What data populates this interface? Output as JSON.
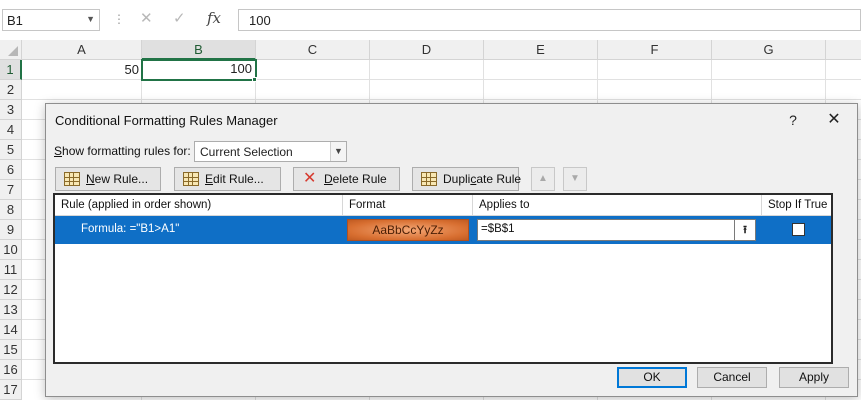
{
  "formula_bar": {
    "name_box": "B1",
    "cancel_icon": "✕",
    "enter_icon": "✓",
    "fx_label": "fx",
    "formula": "100"
  },
  "grid": {
    "columns": [
      "A",
      "B",
      "C",
      "D",
      "E",
      "F",
      "G"
    ],
    "rows": [
      "1",
      "2",
      "3",
      "4",
      "5",
      "6",
      "7",
      "8",
      "9",
      "10",
      "11",
      "12",
      "13",
      "14",
      "15",
      "16",
      "17"
    ],
    "selected_column": "B",
    "selected_row": "1",
    "cells": {
      "A1": "50",
      "B1": "100"
    },
    "accent_color": "#217346"
  },
  "dialog": {
    "title": "Conditional Formatting Rules Manager",
    "help": "?",
    "close": "✕",
    "show_label_pre": "",
    "show_label_u": "S",
    "show_label_post": "how formatting rules for:",
    "show_value": "Current Selection",
    "buttons": {
      "new_rule_u": "N",
      "new_rule_post": "ew Rule...",
      "edit_rule_u": "E",
      "edit_rule_post": "dit Rule...",
      "delete_rule_u": "D",
      "delete_rule_post": "elete Rule",
      "duplicate_pre": "Dupli",
      "duplicate_u": "c",
      "duplicate_post": "ate Rule",
      "move_up": "▲",
      "move_down": "▼"
    },
    "table_headers": {
      "rule": "Rule (applied in order shown)",
      "format": "Format",
      "applies_to": "Applies to",
      "stop_if_true": "Stop If True"
    },
    "rule_rows": [
      {
        "rule": "Formula: =\"B1>A1\"",
        "format_preview": "AaBbCcYyZz",
        "applies_to": "=$B$1",
        "stop_if_true": false
      }
    ],
    "selected_row_color": "#0f6fc6",
    "format_color": "#d86f31",
    "ok": "OK",
    "cancel": "Cancel",
    "apply": "Apply"
  }
}
